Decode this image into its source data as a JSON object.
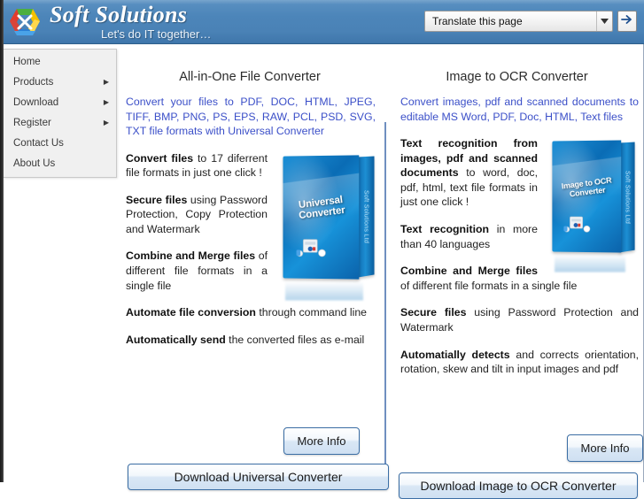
{
  "header": {
    "logo_icon": "recycle-hex-logo",
    "brand_name": "Soft Solutions",
    "tagline": "Let's do IT together…",
    "accent_color": "#4a84b8"
  },
  "translate": {
    "value": "Translate this page",
    "caret_icon": "chevron-down-icon",
    "go_icon": "arrow-right-icon"
  },
  "sidebar": {
    "items": [
      {
        "label": "Home",
        "arrow": ""
      },
      {
        "label": "Products",
        "arrow": "▶"
      },
      {
        "label": "Download",
        "arrow": "▶"
      },
      {
        "label": "Register",
        "arrow": "▶"
      },
      {
        "label": "Contact Us",
        "arrow": ""
      },
      {
        "label": "About Us",
        "arrow": ""
      }
    ]
  },
  "products": {
    "left": {
      "title": "All-in-One File Converter",
      "intro": "Convert your files to PDF, DOC, HTML, JPEG, TIFF, BMP, PNG, PS, EPS, RAW, PCL, PSD, SVG, TXT file formats with Universal Converter",
      "box_title": "Universal Converter",
      "box_spine": "Soft Solutions Ltd",
      "features": [
        {
          "bold": "Convert files",
          "rest": " to 17 diferrent file formats in just one click !"
        },
        {
          "bold": "Secure files",
          "rest": " using Password Protection, Copy Protection and Watermark"
        },
        {
          "bold": "Combine and Merge files",
          "rest": " of different file formats in a single file"
        },
        {
          "bold": "Automate file conversion",
          "rest": " through command line"
        },
        {
          "bold": "Automatically send",
          "rest": " the converted files as e-mail"
        }
      ],
      "more_info_label": "More Info",
      "download_label": "Download Universal Converter"
    },
    "right": {
      "title": "Image to OCR Converter",
      "intro": "Convert images, pdf and scanned documents to editable MS Word, PDF, Doc, HTML, Text files",
      "box_title": "Image to OCR Converter",
      "box_spine": "Soft Solutions Ltd",
      "features": [
        {
          "bold": "Text recognition from images, pdf and scanned documents",
          "rest": " to word, doc, pdf, html, text file formats in just one click !"
        },
        {
          "bold": "Text recognition",
          "rest": " in more than 40 languages"
        },
        {
          "bold": "Combine and Merge files",
          "rest": " of different file formats in a single file"
        },
        {
          "bold": "Secure files",
          "rest": " using Password Protection and Watermark"
        },
        {
          "bold": "Automatially detects",
          "rest": " and corrects orientation, rotation, skew and tilt in input images and pdf"
        }
      ],
      "more_info_label": "More Info",
      "download_label": "Download Image to OCR Converter"
    }
  }
}
